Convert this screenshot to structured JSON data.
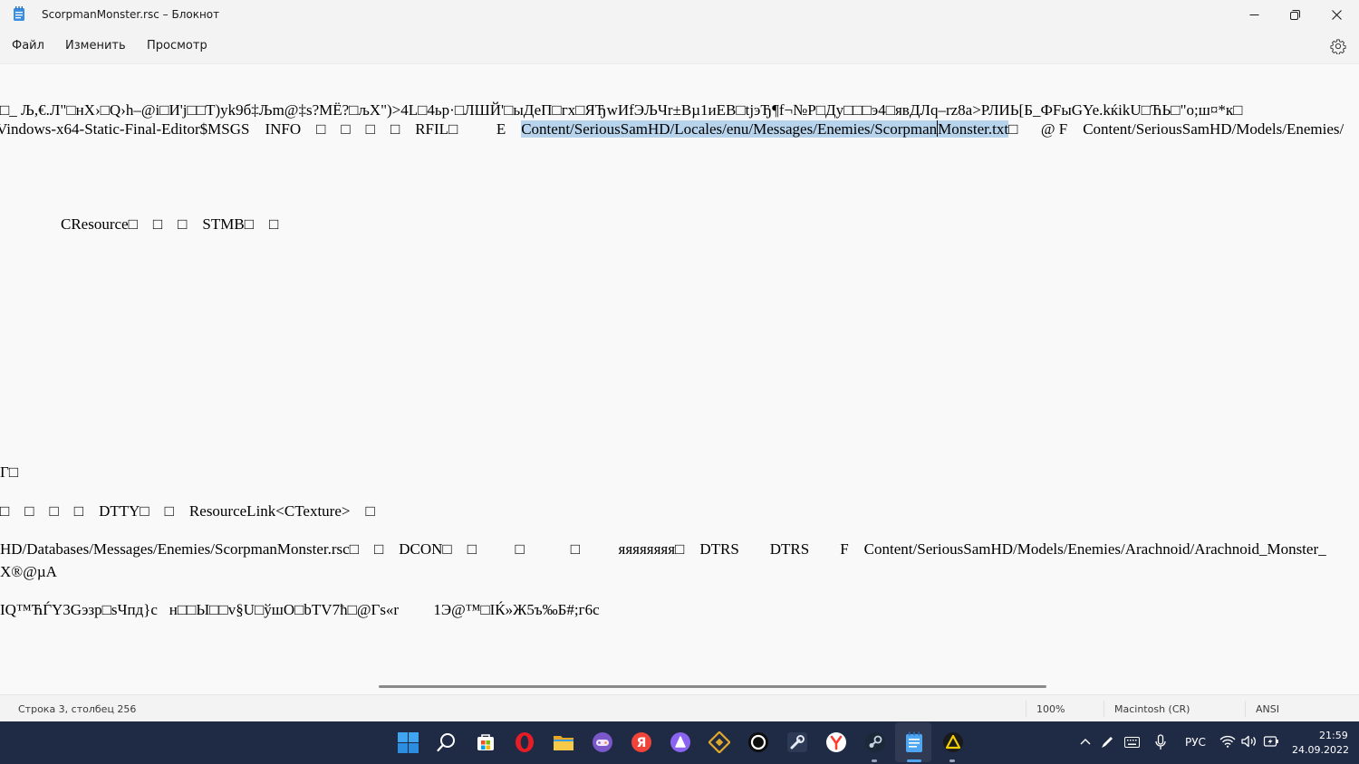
{
  "window": {
    "title": "ScorpmanMonster.rsc – Блокнот",
    "minimize_glyph": "—",
    "maximize_glyph": "❐",
    "close_glyph": "✕"
  },
  "menu": {
    "items": [
      {
        "label": "Файл"
      },
      {
        "label": "Изменить"
      },
      {
        "label": "Просмотр"
      }
    ],
    "settings_icon": "gear-icon"
  },
  "editor": {
    "line1": "□_ Љ,€.Л\"□нХ›□Q›h–@i□И'j□□Т)yk9б‡Љm@‡s?МЁ?□љХ\")>4L□4ьр·□ЛШЙ'□ыДеП□гх□ЯЂwИfЭЉЧr±Вµ1иЕВ□tјэЂ¶f¬№Р□Ду□□□э4□явДЛq–rz8a>РЛИЬ[Б_ФFыGYe.kќikU□ЋЬ□\"o;ш¤*к□",
    "line2_before": "Vindows-x64-Static-Final-Editor$MSGS    INFO    □    □    □    □    RFIL□          E    ",
    "line2_selected_a": "Content/SeriousSamHD/Locales/enu/Messages/Enemies/Scorpman",
    "line2_selected_b": "Monster.txt",
    "line2_after": "□      @ F    Content/SeriousSamHD/Models/Enemies/",
    "line3": "CResource□    □    □    STMB□    □",
    "line4": "Г□",
    "line5": "□    □    □    □    DTTY□    □    ResourceLink<CTexture>    □",
    "line6": "HD/Databases/Messages/Enemies/ScorpmanMonster.rsc□    □    DCON□    □          □            □          яяяяяяяя□    DTRS        DTRS        F    Content/SeriousSamHD/Models/Enemies/Arachnoid/Arachnoid_Monster_",
    "line7": "X®@µA",
    "line8": "IQ™ЋЃY3Gэзр□sЧпд}с   н□□Ы□□v§U□ўшО□bTV7ћ□@Гs«r         1Э@™□IЌ»Ж5ъ‰Б#;г6с"
  },
  "status": {
    "position": "Строка 3, столбец 256",
    "zoom": "100%",
    "line_ending": "Macintosh (CR)",
    "encoding": "ANSI"
  },
  "taskbar": {
    "icons": [
      {
        "name": "start-icon",
        "color": "#3a9bea"
      },
      {
        "name": "search-icon",
        "color": "#ffffff"
      },
      {
        "name": "store-icon",
        "color": "#ffffff"
      },
      {
        "name": "opera-icon",
        "color": "#e81c24"
      },
      {
        "name": "file-explorer-icon",
        "color": "#f5c242"
      },
      {
        "name": "gamepad-icon",
        "color": "#8e6cd1"
      },
      {
        "name": "yandex-icon",
        "color": "#f0433a"
      },
      {
        "name": "alice-icon",
        "color": "#8a63f0"
      },
      {
        "name": "binance-icon",
        "color": "#e0a92c"
      },
      {
        "name": "circle-app-icon",
        "color": "#ffffff"
      },
      {
        "name": "tools-icon",
        "color": "#c8d3e6"
      },
      {
        "name": "yandex-browser-icon",
        "color": "#ff3b30"
      },
      {
        "name": "steam-icon",
        "color": "#c6d4df"
      },
      {
        "name": "notepad-icon",
        "color": "#4ea6f2"
      },
      {
        "name": "warning-app-icon",
        "color": "#f5d000"
      }
    ],
    "tray": {
      "chevron": "^",
      "language": "РУС",
      "time": "21:59",
      "date": "24.09.2022"
    }
  }
}
